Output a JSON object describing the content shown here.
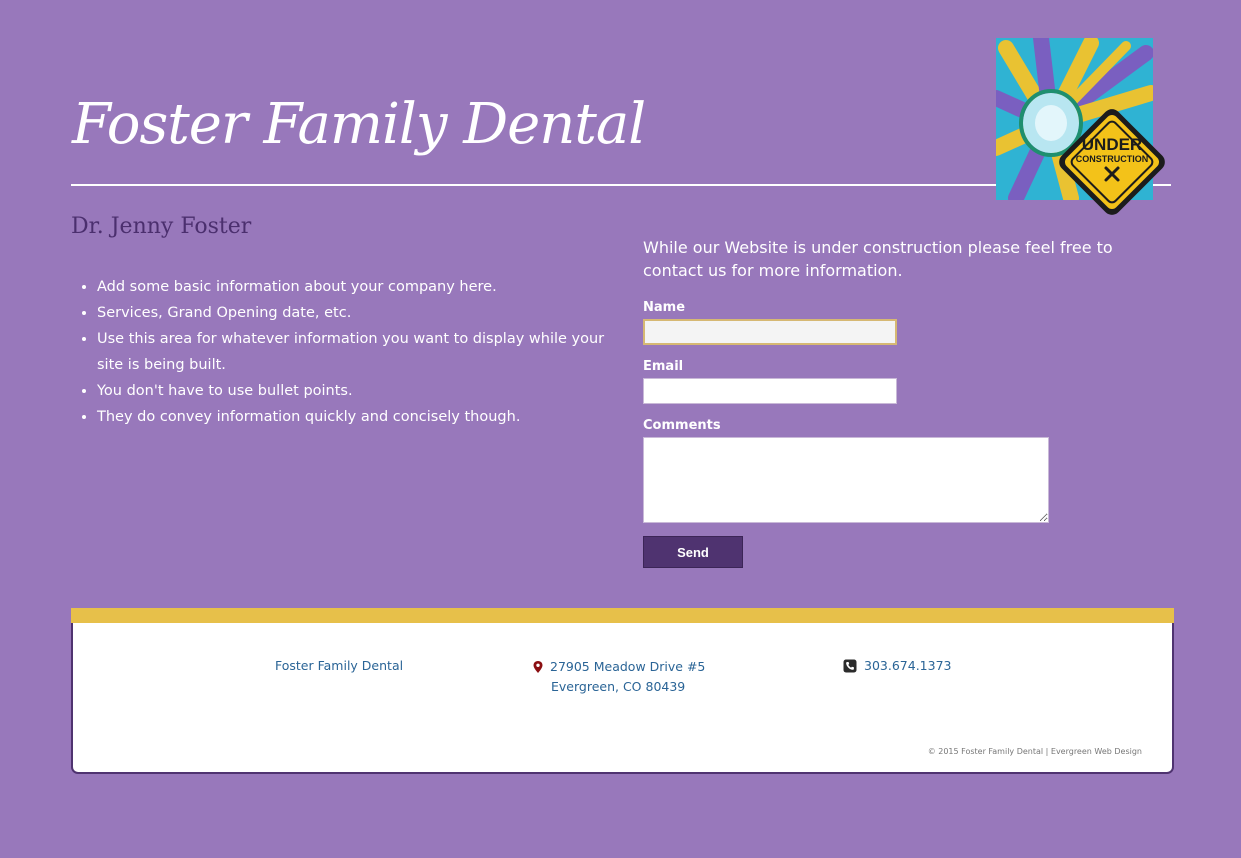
{
  "header": {
    "title": "Foster Family Dental",
    "badge": {
      "line1": "UNDER",
      "line2": "CONSTRUCTION"
    }
  },
  "main": {
    "doctor_name": "Dr. Jenny Foster",
    "bullets": [
      "Add some basic information about your company here.",
      "Services, Grand Opening date, etc.",
      "Use this area for whatever information you want to display while your site is being built.",
      "You don't have to use bullet points.",
      "They do convey information quickly and concisely though."
    ]
  },
  "contact_form": {
    "intro": "While our Website is under construction please feel free to contact us for more information.",
    "name_label": "Name",
    "name_value": "",
    "email_label": "Email",
    "email_value": "",
    "comments_label": "Comments",
    "comments_value": "",
    "send_label": "Send"
  },
  "footer": {
    "business_name": "Foster Family Dental",
    "address_line1": "27905 Meadow Drive #5",
    "address_line2": "Evergreen, CO 80439",
    "phone": "303.674.1373",
    "copyright": "© 2015 Foster Family Dental | Evergreen Web Design",
    "icons": {
      "address": "map-marker-icon",
      "phone": "phone-icon"
    }
  },
  "colors": {
    "background": "#9878bb",
    "accent_dark": "#4f3370",
    "footer_band": "#e7c04a",
    "link": "#2a6496"
  }
}
